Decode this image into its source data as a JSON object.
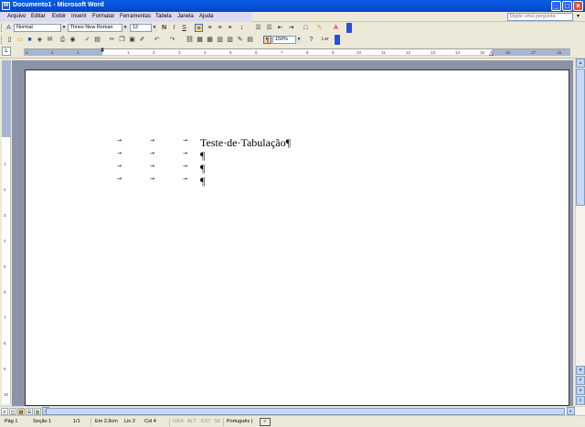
{
  "window": {
    "title": "Documento1 - Microsoft Word",
    "icon": "W"
  },
  "menu": [
    "Arquivo",
    "Editar",
    "Exibir",
    "Inserir",
    "Formatar",
    "Ferramentas",
    "Tabela",
    "Janela",
    "Ajuda"
  ],
  "help_box": {
    "placeholder": "Digite uma pergunta"
  },
  "formatting": {
    "style": "Normal",
    "font": "Times New Roman",
    "size": "12",
    "zoom": "150%",
    "read_label": "Ler"
  },
  "ruler_numbers": [
    "3",
    "2",
    "1",
    "1",
    "2",
    "3",
    "4",
    "5",
    "6",
    "7",
    "8",
    "9",
    "10",
    "11",
    "12",
    "13",
    "14",
    "15",
    "16",
    "17",
    "18"
  ],
  "vruler_numbers": [
    "1",
    "2",
    "3",
    "4",
    "5",
    "6",
    "7",
    "8",
    "9",
    "10",
    "11",
    "12"
  ],
  "document": {
    "lines": [
      {
        "text": "Teste·de·Tabulação¶"
      },
      {
        "text": "¶"
      },
      {
        "text": "¶"
      },
      {
        "text": "¶"
      }
    ],
    "tab_symbol": "→"
  },
  "status": {
    "page": "Pág 1",
    "section": "Seção 1",
    "page_count": "1/1",
    "position": "Em 2,9cm",
    "line": "Lin 2",
    "column": "Col 4",
    "gra": "GRA",
    "alt": "ALT",
    "est": "EST",
    "se": "SE",
    "language": "Português ("
  },
  "colors": {
    "titlebar": "#0650d6",
    "page_bg": "#ffffff",
    "workspace": "#8a93a8"
  }
}
